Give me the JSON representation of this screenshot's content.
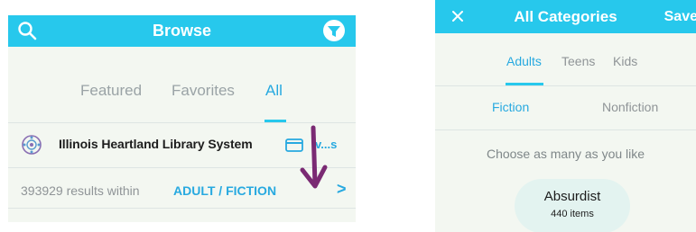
{
  "browse": {
    "title": "Browse",
    "icons": {
      "left": "search-icon",
      "right": "filter-icon"
    },
    "tabs": [
      {
        "label": "Featured",
        "active": false
      },
      {
        "label": "Favorites",
        "active": false
      },
      {
        "label": "All",
        "active": true
      }
    ],
    "library": {
      "name": "Illinois Heartland Library System",
      "switch_label": "v...s",
      "icons": [
        "library-logo-icon",
        "card-icon"
      ]
    },
    "results": {
      "count_text": "393929 results within",
      "filter": "ADULT / FICTION",
      "chevron": ">"
    },
    "annotation": {
      "icon": "down-arrow-icon",
      "color": "#7a2a73"
    }
  },
  "categories": {
    "title": "All Categories",
    "close_icon": "close-icon",
    "save_label": "Save",
    "audience_tabs": [
      {
        "label": "Adults",
        "active": true
      },
      {
        "label": "Teens",
        "active": false
      },
      {
        "label": "Kids",
        "active": false
      }
    ],
    "genre_tabs": [
      {
        "label": "Fiction",
        "active": true
      },
      {
        "label": "Nonfiction",
        "active": false
      }
    ],
    "hint": "Choose as many as you like",
    "chips": [
      {
        "name": "Absurdist",
        "count": "440 items"
      }
    ]
  },
  "colors": {
    "header": "#27c8ec",
    "accent": "#27a9e0",
    "panel_bg": "#f3f7f1",
    "chip_bg": "#e3f3f0"
  }
}
